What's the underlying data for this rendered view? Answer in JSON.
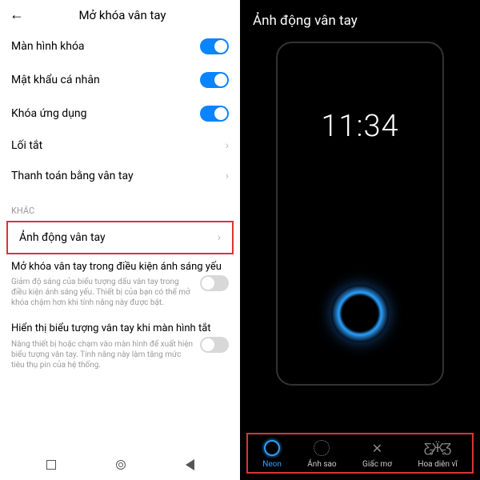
{
  "left": {
    "title": "Mở khóa vân tay",
    "toggles": [
      {
        "label": "Màn hình khóa",
        "on": true
      },
      {
        "label": "Mật khẩu cá nhân",
        "on": true
      },
      {
        "label": "Khóa ứng dụng",
        "on": true
      }
    ],
    "links": [
      {
        "label": "Lối tắt"
      },
      {
        "label": "Thanh toán bằng vân tay"
      }
    ],
    "section": "KHÁC",
    "highlighted": "Ảnh động vân tay",
    "disabled": [
      {
        "title": "Mở khóa vân tay trong điều kiện ánh sáng yếu",
        "sub": "Giảm độ sáng của biểu tượng dấu vân tay trong điều kiện ánh sáng yếu. Thiết bị của bạn có thể mở khóa chậm hơn khi tính năng này được bật."
      },
      {
        "title": "Hiển thị biểu tượng vân tay khi màn hình tắt",
        "sub": "Nâng thiết bị hoặc chạm vào màn hình để xuất hiện biểu tượng vân tay. Tính năng này làm tăng mức tiêu thụ pin của hệ thống."
      }
    ]
  },
  "right": {
    "title": "Ảnh động vân tay",
    "clock": "11:34",
    "options": [
      {
        "label": "Neon",
        "selected": true
      },
      {
        "label": "Ánh sao",
        "selected": false
      },
      {
        "label": "Giấc mơ",
        "selected": false
      },
      {
        "label": "Hoa diên vĩ",
        "selected": false
      }
    ]
  }
}
